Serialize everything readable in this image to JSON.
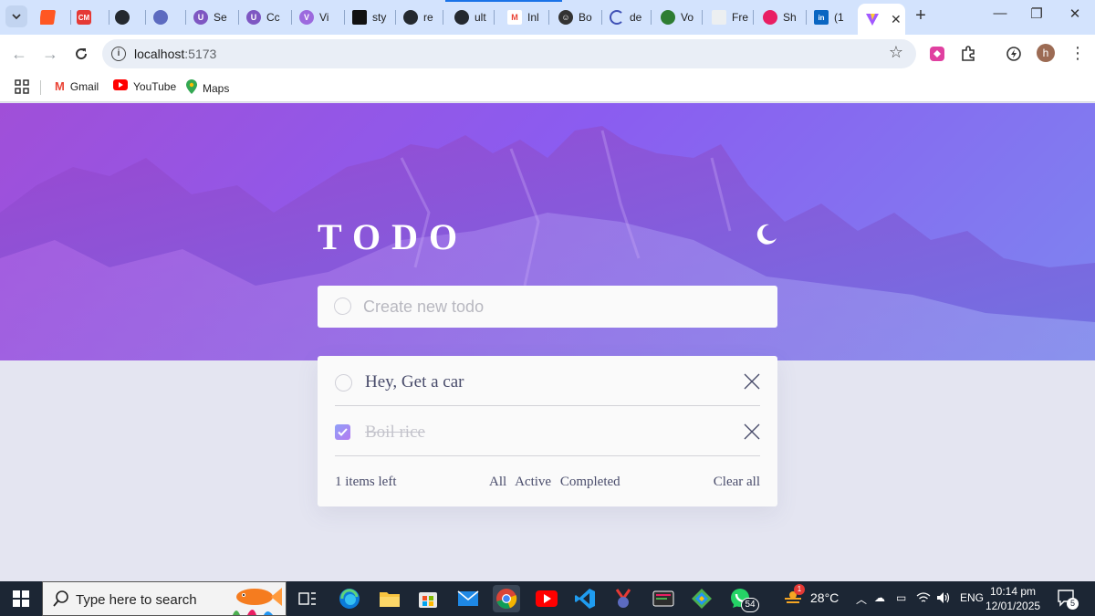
{
  "browser": {
    "tabs": [
      {
        "label": "",
        "color": "#ff5722"
      },
      {
        "label": "",
        "color": "#e53935"
      },
      {
        "label": "",
        "color": "#24292f"
      },
      {
        "label": "",
        "color": "#5c6bc0"
      },
      {
        "label": "Se",
        "color": "#7e57c2"
      },
      {
        "label": "Cc",
        "color": "#7e57c2"
      },
      {
        "label": "Vi",
        "color": "#9c6ade"
      },
      {
        "label": "sty",
        "color": "#111111"
      },
      {
        "label": "re",
        "color": "#24292f"
      },
      {
        "label": "ult",
        "color": "#24292f"
      },
      {
        "label": "Inl",
        "color": "#ea4335"
      },
      {
        "label": "Bo",
        "color": "#333333"
      },
      {
        "label": "de",
        "color": "#3f51b5"
      },
      {
        "label": "Vo",
        "color": "#2e7d32"
      },
      {
        "label": "Fre",
        "color": "#607d8b"
      },
      {
        "label": "Sh",
        "color": "#e91e63"
      },
      {
        "label": "(1",
        "color": "#0a66c2"
      }
    ],
    "active_tab_icon": "vite-icon",
    "new_tab_label": "+",
    "url_host": "localhost",
    "url_port": ":5173",
    "bookmarks": [
      {
        "label": "Gmail",
        "icon": "gmail-icon"
      },
      {
        "label": "YouTube",
        "icon": "youtube-icon"
      },
      {
        "label": "Maps",
        "icon": "maps-icon"
      }
    ],
    "profile_initial": "h"
  },
  "app": {
    "title": "TODO",
    "new_todo_placeholder": "Create new todo",
    "todos": [
      {
        "text": "Hey, Get a car",
        "completed": false
      },
      {
        "text": "Boil rice",
        "completed": true
      }
    ],
    "footer": {
      "items_left": "1 items left",
      "filters": [
        "All",
        "Active",
        "Completed"
      ],
      "clear": "Clear all"
    },
    "colors": {
      "hero_start": "#a04fd8",
      "hero_end": "#7d86f0",
      "page_bg": "#e4e5f1",
      "card_bg": "#fafafa"
    }
  },
  "taskbar": {
    "search_placeholder": "Type here to search",
    "whatsapp_badge": "54",
    "weather_temp": "28°C",
    "weather_alert": "1",
    "language": "ENG",
    "time": "10:14 pm",
    "date": "12/01/2025",
    "notification_count": "5"
  }
}
